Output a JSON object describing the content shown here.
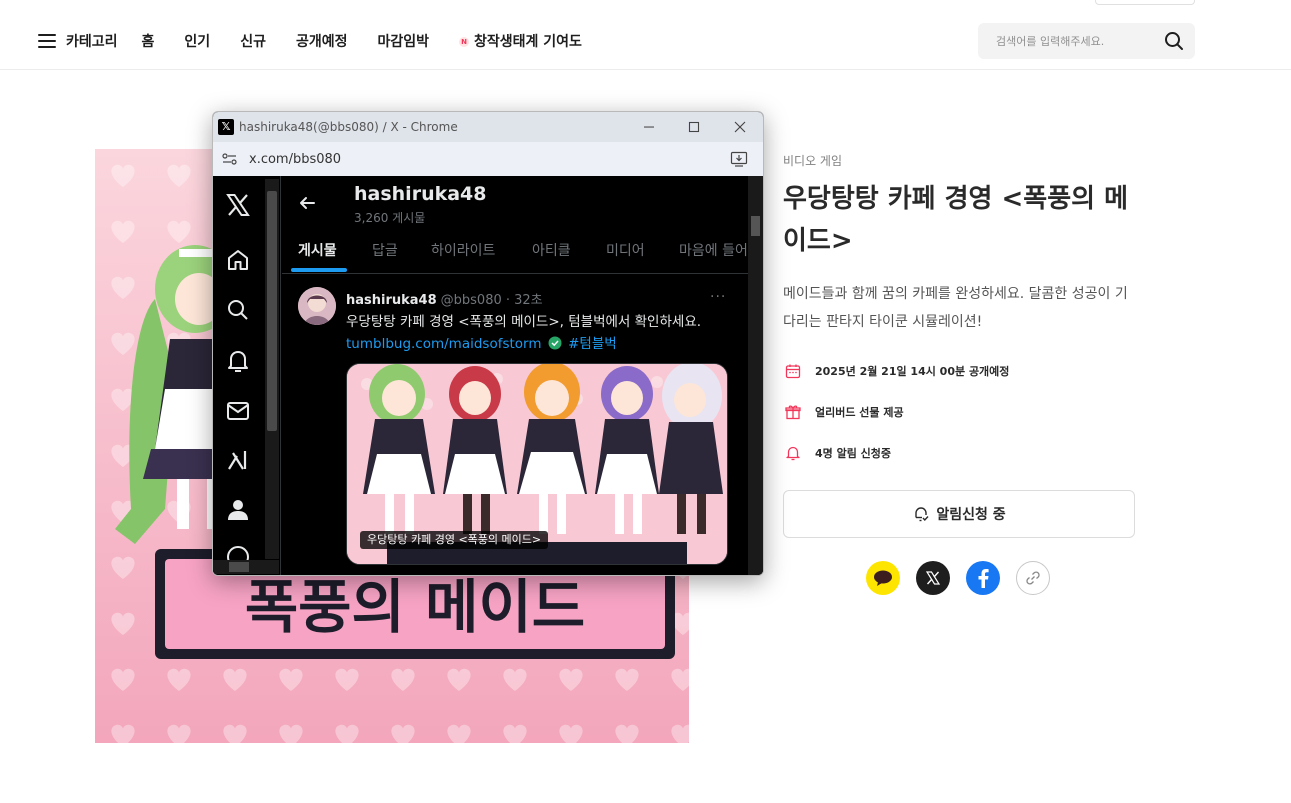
{
  "nav": {
    "category_label": "카테고리",
    "items": [
      "홈",
      "인기",
      "신규",
      "공개예정",
      "마감임박"
    ],
    "special_badge": "N",
    "special_item": "창작생태계 기여도",
    "search_placeholder": "검색어를 입력해주세요."
  },
  "project": {
    "category": "비디오 게임",
    "title": "우당탕탕 카페 경영 <폭풍의 메이드>",
    "description": "메이드들과 함께 꿈의 카페를 완성하세요. 달콤한 성공이 기다리는 판타지 타이쿤 시뮬레이션!",
    "cover_logo_text": "폭풍의 메이드",
    "meta": {
      "launch": "2025년 2월 21일 14시 00분 공개예정",
      "gift": "얼리버드 선물 제공",
      "alerts": "4명 알림 신청중"
    },
    "notify_button": "알림신청 중",
    "share_icons": [
      "kakaotalk-icon",
      "x-icon",
      "facebook-icon",
      "link-icon"
    ],
    "accent_color": "#f2375a"
  },
  "chrome": {
    "window_title": "hashiruka48(@bbs080) / X - Chrome",
    "url": "x.com/bbs080"
  },
  "x": {
    "profile_name": "hashiruka48",
    "post_count": "3,260 게시물",
    "tabs": [
      "게시물",
      "답글",
      "하이라이트",
      "아티클",
      "미디어",
      "마음에 들어"
    ],
    "active_tab": "게시물",
    "tweet": {
      "name": "hashiruka48",
      "handle": "@bbs080 · 32초",
      "text": "우당탕탕 카페 경영 <폭풍의 메이드>, 텀블벅에서 확인하세요.",
      "link": "tumblbug.com/maidsofstorm",
      "hashtag": "#텀블벅",
      "image_caption": "우당탕탕 카페 경영 <폭풍의 메이드>"
    },
    "accent_color": "#1d9bf0"
  }
}
